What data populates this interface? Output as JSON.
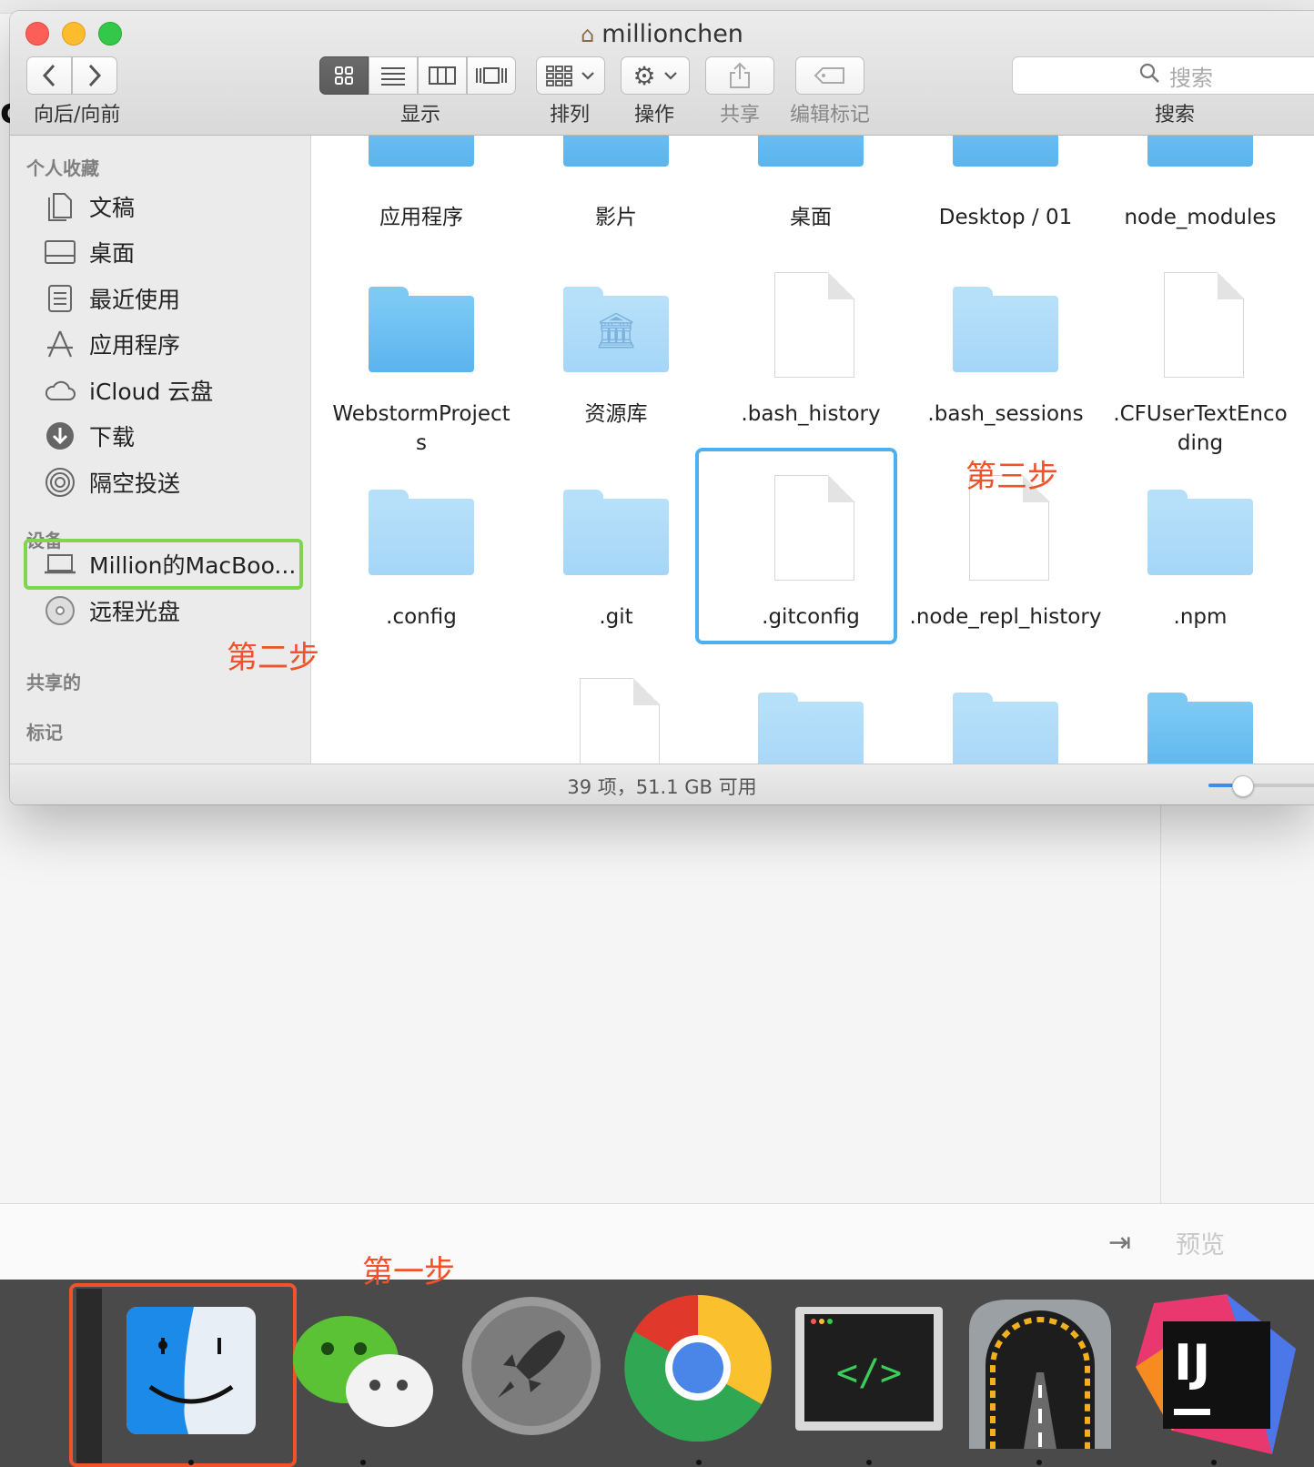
{
  "window": {
    "title": "millionchen"
  },
  "toolbar": {
    "nav_label": "向后/向前",
    "view_label": "显示",
    "arrange_label": "排列",
    "action_label": "操作",
    "share_label": "共享",
    "tags_label": "编辑标记",
    "search_label": "搜索",
    "search_placeholder": "搜索"
  },
  "sidebar": {
    "favorites_header": "个人收藏",
    "favorites": [
      {
        "label": "文稿",
        "icon": "documents-icon"
      },
      {
        "label": "桌面",
        "icon": "desktop-icon"
      },
      {
        "label": "最近使用",
        "icon": "recents-icon"
      },
      {
        "label": "应用程序",
        "icon": "applications-icon"
      },
      {
        "label": "iCloud 云盘",
        "icon": "icloud-icon"
      },
      {
        "label": "下载",
        "icon": "downloads-icon"
      },
      {
        "label": "隔空投送",
        "icon": "airdrop-icon"
      }
    ],
    "devices_header": "设备",
    "devices": [
      {
        "label": "Million的MacBoo...",
        "icon": "laptop-icon"
      },
      {
        "label": "远程光盘",
        "icon": "disc-icon"
      }
    ],
    "shared_header": "共享的",
    "tags_header": "标记"
  },
  "files": {
    "row1": [
      "应用程序",
      "影片",
      "桌面",
      "Desktop / 01",
      "node_modules"
    ],
    "row2": [
      "WebstormProject\ns",
      "资源库",
      ".bash_history",
      ".bash_sessions",
      ".CFUserTextEnco\nding"
    ],
    "row3": [
      ".config",
      ".git",
      ".gitconfig",
      ".node_repl_history",
      ".npm"
    ]
  },
  "statusbar": {
    "text": "39 项，51.1 GB 可用",
    "zoom_level": 0.3
  },
  "annotations": {
    "step1": "第一步",
    "step2": "第二步",
    "step3": "第三步"
  },
  "background": {
    "preview_label": "预览"
  },
  "dock": {
    "apps": [
      "finder-icon",
      "wechat-icon",
      "launchpad-icon",
      "chrome-icon",
      "code-editor-icon",
      "tunnel-app-icon",
      "intellij-icon"
    ]
  },
  "colors": {
    "annotation": "#f0522b",
    "device_highlight": "#7fd64d",
    "selection": "#4fb0f0",
    "folder": "#5ab4ee"
  }
}
